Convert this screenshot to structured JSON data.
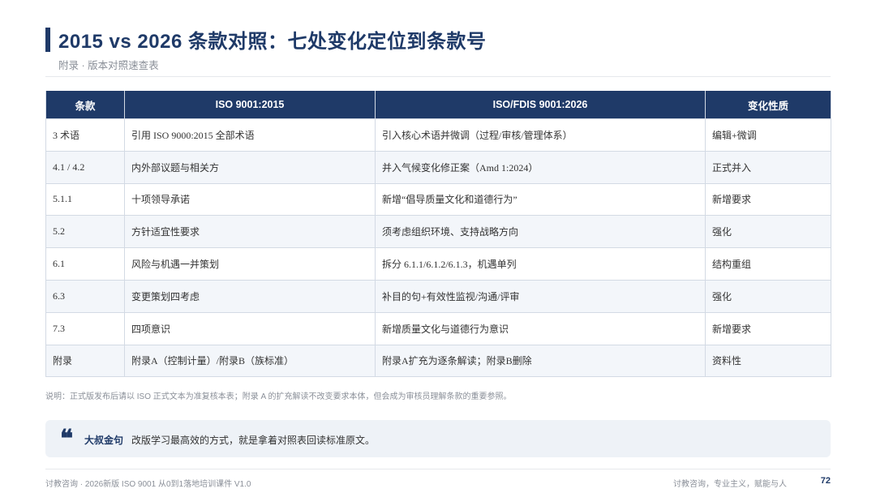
{
  "header": {
    "title": "2015 vs 2026 条款对照：七处变化定位到条款号",
    "subtitle": "附录 · 版本对照速查表"
  },
  "table": {
    "headers": [
      "条款",
      "ISO 9001:2015",
      "ISO/FDIS 9001:2026",
      "变化性质"
    ],
    "rows": [
      [
        "3 术语",
        "引用 ISO 9000:2015 全部术语",
        "引入核心术语并微调（过程/审核/管理体系）",
        "编辑+微调"
      ],
      [
        "4.1 / 4.2",
        "内外部议题与相关方",
        "并入气候变化修正案（Amd 1:2024）",
        "正式并入"
      ],
      [
        "5.1.1",
        "十项领导承诺",
        "新增“倡导质量文化和道德行为”",
        "新增要求"
      ],
      [
        "5.2",
        "方针适宜性要求",
        "须考虑组织环境、支持战略方向",
        "强化"
      ],
      [
        "6.1",
        "风险与机遇一并策划",
        "拆分 6.1.1/6.1.2/6.1.3，机遇单列",
        "结构重组"
      ],
      [
        "6.3",
        "变更策划四考虑",
        "补目的句+有效性监视/沟通/评审",
        "强化"
      ],
      [
        "7.3",
        "四项意识",
        "新增质量文化与道德行为意识",
        "新增要求"
      ],
      [
        "附录",
        "附录A（控制计量）/附录B（族标准）",
        "附录A扩充为逐条解读；附录B删除",
        "资料性"
      ]
    ]
  },
  "note": "说明：正式版发布后请以 ISO 正式文本为准复核本表；附录 A 的扩充解读不改变要求本体，但会成为审核员理解条款的重要参照。",
  "quote": {
    "mark": "❝",
    "label": "大叔金句",
    "text": "改版学习最高效的方式，就是拿着对照表回读标准原文。"
  },
  "footer": {
    "left": "讨教咨询 · 2026新版 ISO 9001 从0到1落地培训课件 V1.0",
    "right": "讨教咨询，专业主义，赋能与人",
    "page": "72"
  },
  "colors": {
    "accent": "#1f3a68",
    "row_alt": "#f3f6fa",
    "quote_bg": "#eef2f7"
  }
}
